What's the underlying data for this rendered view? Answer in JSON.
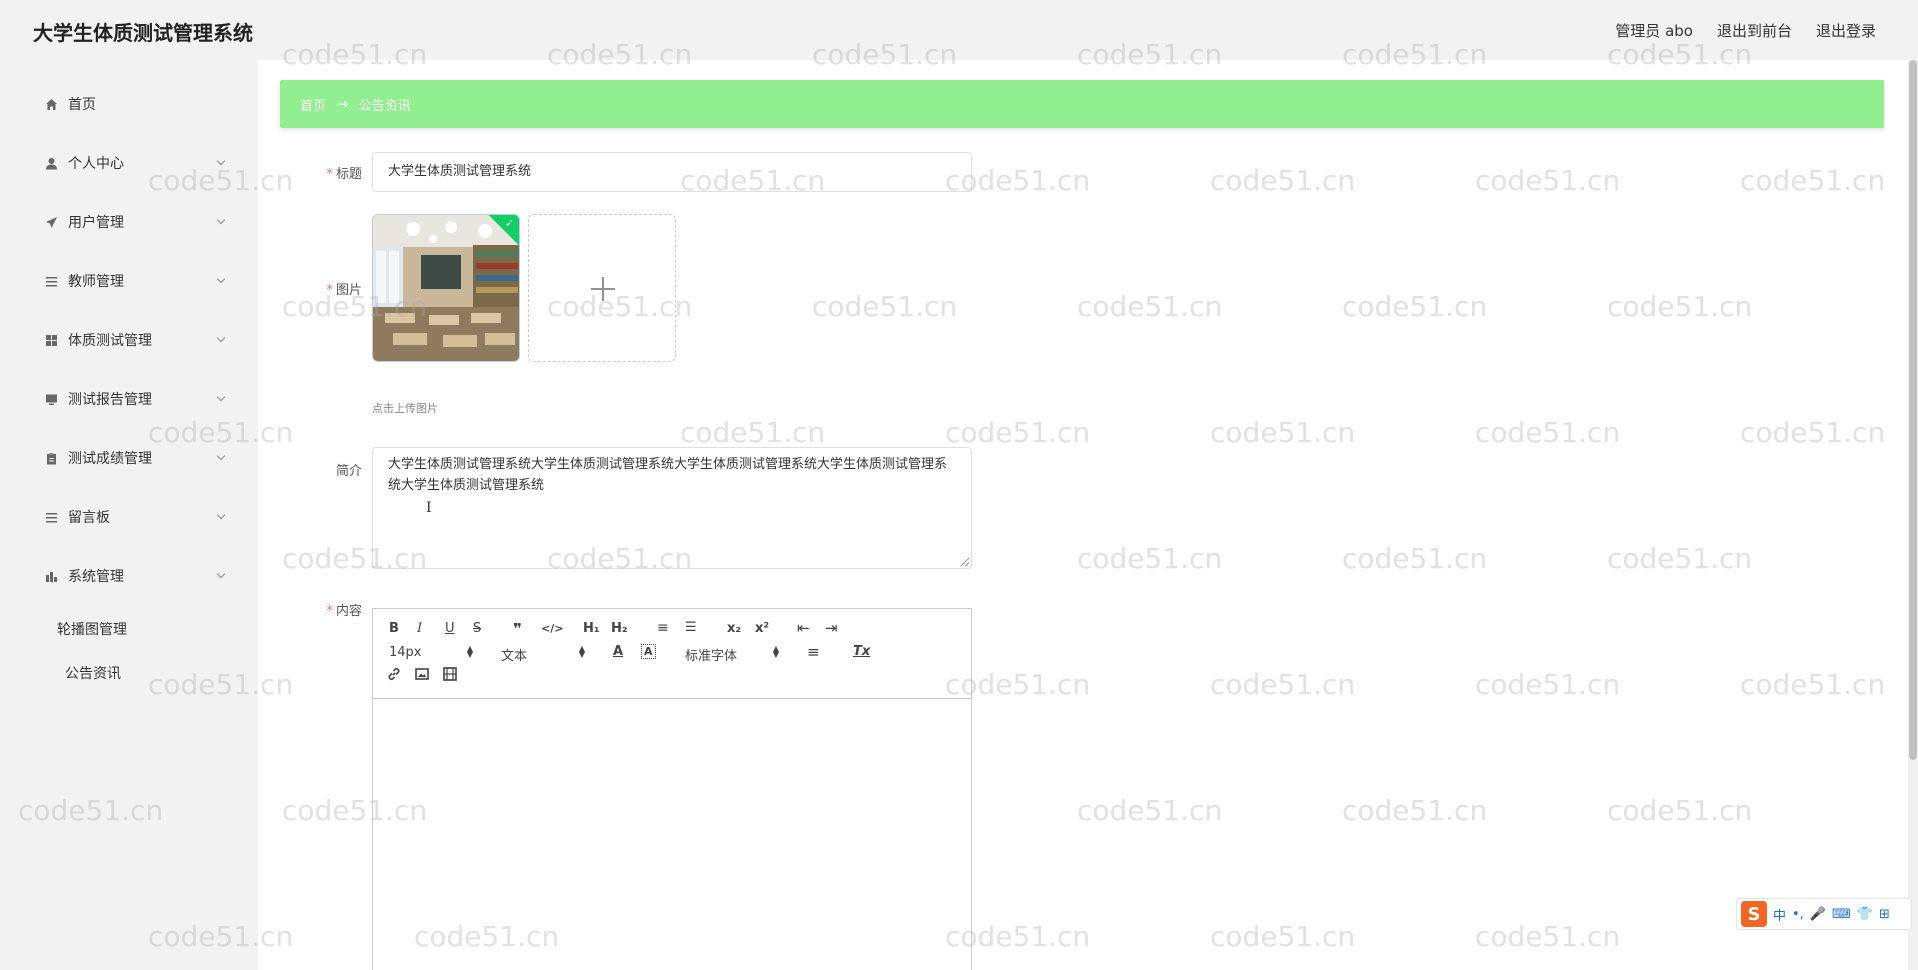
{
  "app": {
    "title": "大学生体质测试管理系统"
  },
  "header": {
    "user_label": "管理员 abo",
    "frontend_link": "退出到前台",
    "logout_link": "退出登录"
  },
  "sidebar": {
    "items": [
      {
        "label": "首页",
        "icon": "home-icon"
      },
      {
        "label": "个人中心",
        "icon": "user-icon"
      },
      {
        "label": "用户管理",
        "icon": "send-icon"
      },
      {
        "label": "教师管理",
        "icon": "list-icon"
      },
      {
        "label": "体质测试管理",
        "icon": "grid-icon"
      },
      {
        "label": "测试报告管理",
        "icon": "monitor-icon"
      },
      {
        "label": "测试成绩管理",
        "icon": "clipboard-icon"
      },
      {
        "label": "留言板",
        "icon": "list-icon"
      },
      {
        "label": "系统管理",
        "icon": "chart-icon"
      }
    ],
    "sub_items": [
      "轮播图管理",
      "公告资讯"
    ]
  },
  "breadcrumb": {
    "home": "首页",
    "arrow": "→",
    "current": "公告资讯"
  },
  "form": {
    "title_label": "标题",
    "title_value": "大学生体质测试管理系统",
    "image_label": "图片",
    "upload_hint": "点击上传图片",
    "intro_label": "简介",
    "intro_value": "大学生体质测试管理系统大学生体质测试管理系统大学生体质测试管理系统大学生体质测试管理系统大学生体质测试管理系统",
    "text_cursor": "I",
    "content_label": "内容"
  },
  "editor": {
    "bold": "B",
    "italic": "I",
    "underline": "U",
    "strike": "S",
    "quote": "❞",
    "code": "</>",
    "h1": "H₁",
    "h2": "H₂",
    "ordered_list": "≡",
    "bullet_list": "☰",
    "subscript": "x₂",
    "superscript": "x²",
    "outdent": "⇤",
    "indent": "⇥",
    "font_size": "14px",
    "text_type": "文本",
    "font_color": "A",
    "background_color": "A",
    "font_family": "标准字体",
    "align": "≡",
    "clear_format": "Tx",
    "link": "🔗",
    "image": "▣",
    "video": "▤"
  },
  "watermark": "code51.cn",
  "ime": {
    "logo": "S",
    "lang": "中",
    "punct": "•,",
    "mic": "🎤",
    "keyboard": "⌨",
    "skin": "👕",
    "grid": "⊞"
  }
}
